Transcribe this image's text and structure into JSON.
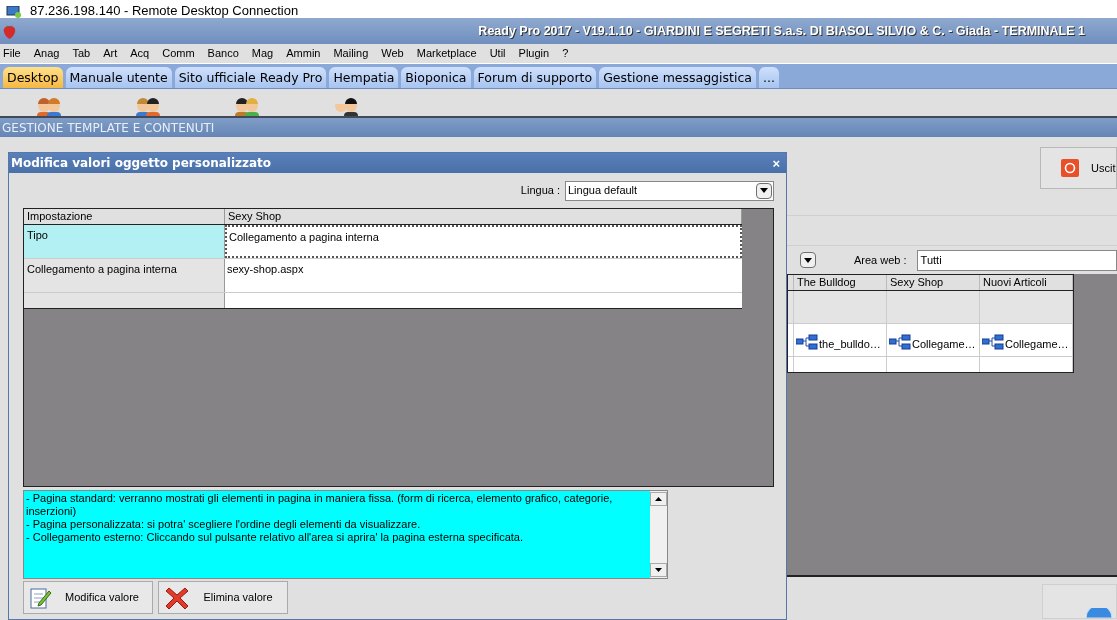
{
  "remote_window": {
    "title": "87.236.198.140 - Remote Desktop Connection"
  },
  "app": {
    "title": "Ready Pro 2017 - V19.1.10 - GIARDINI E SEGRETI S.a.s. DI BIASOL SILVIO & C. - Giada - TERMINALE 1"
  },
  "menu": [
    "File",
    "Anag",
    "Tab",
    "Art",
    "Acq",
    "Comm",
    "Banco",
    "Mag",
    "Ammin",
    "Mailing",
    "Web",
    "Marketplace",
    "Util",
    "Plugin",
    "?"
  ],
  "tabs": [
    {
      "label": "Desktop",
      "selected": true
    },
    {
      "label": "Manuale utente",
      "selected": false
    },
    {
      "label": "Sito ufficiale Ready Pro",
      "selected": false
    },
    {
      "label": "Hempatia",
      "selected": false
    },
    {
      "label": "Bioponica",
      "selected": false
    },
    {
      "label": "Forum di supporto",
      "selected": false
    },
    {
      "label": "Gestione messaggistica",
      "selected": false
    },
    {
      "label": "...",
      "selected": false
    }
  ],
  "section_title": "GESTIONE TEMPLATE E CONTENUTI",
  "background": {
    "exit_button": "Uscit",
    "area_web": {
      "label": "Area web :",
      "value": "Tutti"
    },
    "grid": {
      "columns": [
        "The Bulldog",
        "Sexy Shop",
        "Nuovi Articoli"
      ],
      "links": [
        "the_bulldo…",
        "Collegame…",
        "Collegame…"
      ]
    }
  },
  "dialog": {
    "title": "Modifica valori oggetto personalizzato",
    "close": "×",
    "language": {
      "label": "Lingua :",
      "value": "Lingua default"
    },
    "table": {
      "columns": [
        "Impostazione",
        "Sexy Shop"
      ],
      "rows": [
        {
          "setting": "Tipo",
          "value": "Collegamento a pagina interna",
          "selected": true
        },
        {
          "setting": "Collegamento a pagina interna",
          "value": "sexy-shop.aspx",
          "selected": false
        }
      ]
    },
    "description": [
      "- Pagina standard: verranno mostrati gli elementi in pagina in maniera fissa. (form di ricerca, elemento grafico, categorie, inserzioni)",
      "- Pagina personalizzata: si potra' scegliere l'ordine degli elementi da visualizzare.",
      "- Collegamento esterno: Cliccando sul pulsante relativo all'area si aprira' la pagina esterna specificata."
    ],
    "buttons": [
      {
        "label": "Modifica valore",
        "kind": "edit"
      },
      {
        "label": "Elimina valore",
        "kind": "delete"
      }
    ]
  }
}
